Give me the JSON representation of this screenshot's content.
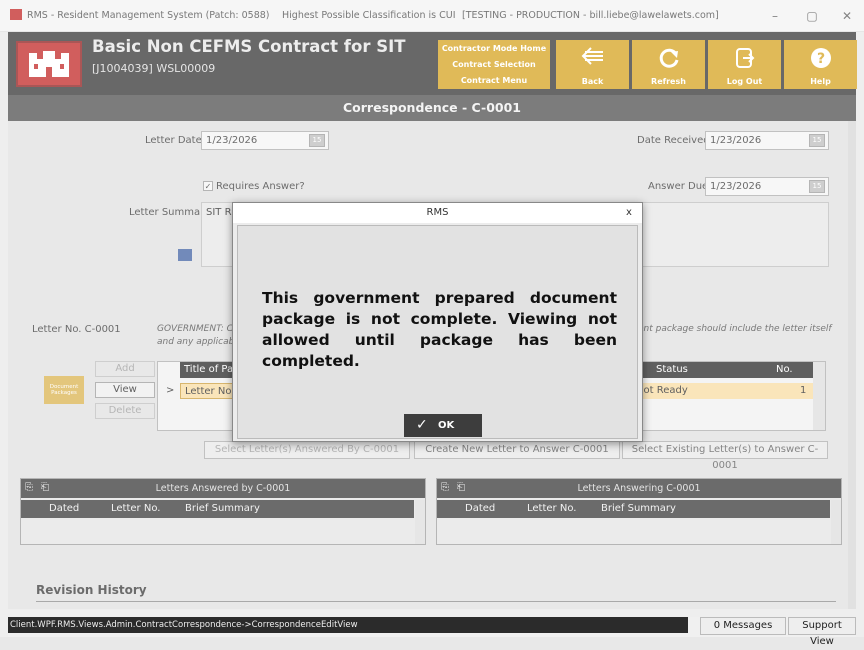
{
  "window": {
    "title": "RMS - Resident Management System (Patch: 0588)",
    "classification": "Highest Possible Classification is CUI",
    "environment": "[TESTING - PRODUCTION - bill.liebe@lawelawets.com]",
    "minimize": "–",
    "maximize": "▢",
    "close": "✕"
  },
  "header": {
    "title": "Basic Non CEFMS Contract for SIT",
    "subtitle": "[J1004039] WSL00009",
    "context_buttons": [
      "Contractor Mode Home",
      "Contract Selection",
      "Contract Menu"
    ],
    "nav_buttons": {
      "back": "Back",
      "refresh": "Refresh",
      "logout": "Log Out",
      "help": "Help"
    }
  },
  "page_title": "Correspondence - C-0001",
  "form": {
    "letter_dated_label": "Letter Dated",
    "letter_dated_value": "1/23/2026",
    "date_received_label": "Date Received",
    "date_received_value": "1/23/2026",
    "requires_answer_label": "Requires Answer?",
    "answer_due_label": "Answer Due",
    "answer_due_value": "1/23/2026",
    "letter_summary_label": "Letter Summary",
    "letter_summary_value": "SIT RN",
    "letter_no": "Letter No. C-0001",
    "note_left": "GOVERNMENT: C",
    "note_left_2": "and any applicab",
    "note_right": "ent package should include the letter itself"
  },
  "packages": {
    "add": "Add",
    "view": "View",
    "delete": "Delete",
    "icon_label": "Document Packages",
    "columns": {
      "title": "Title of Pac",
      "status": "Status",
      "no": "No."
    },
    "row": {
      "arrow": ">",
      "title": "Letter No. C",
      "status": "Not Ready",
      "no": "1"
    }
  },
  "actions": {
    "answered_by": "Select Letter(s) Answered By C-0001",
    "create_new": "Create New Letter to Answer C-0001",
    "select_existing": "Select Existing Letter(s) to Answer C-0001"
  },
  "panels": {
    "left_title": "Letters Answered by C-0001",
    "right_title": "Letters Answering C-0001",
    "col_dated": "Dated",
    "col_letter_no": "Letter No.",
    "col_summary": "Brief Summary"
  },
  "revision_history": "Revision History",
  "dialog": {
    "title": "RMS",
    "close": "x",
    "message": "This government prepared document package is not complete. Viewing not allowed until package has been completed.",
    "ok": "OK"
  },
  "status_bar": {
    "path": "Client.WPF.RMS.Views.Admin.ContractCorrespondence->CorrespondenceEditView",
    "messages": "0 Messages",
    "support": "Support View"
  },
  "colors": {
    "accent": "#d4a018",
    "header_bg": "#2e2e2e",
    "brand_red": "#c0201f"
  }
}
